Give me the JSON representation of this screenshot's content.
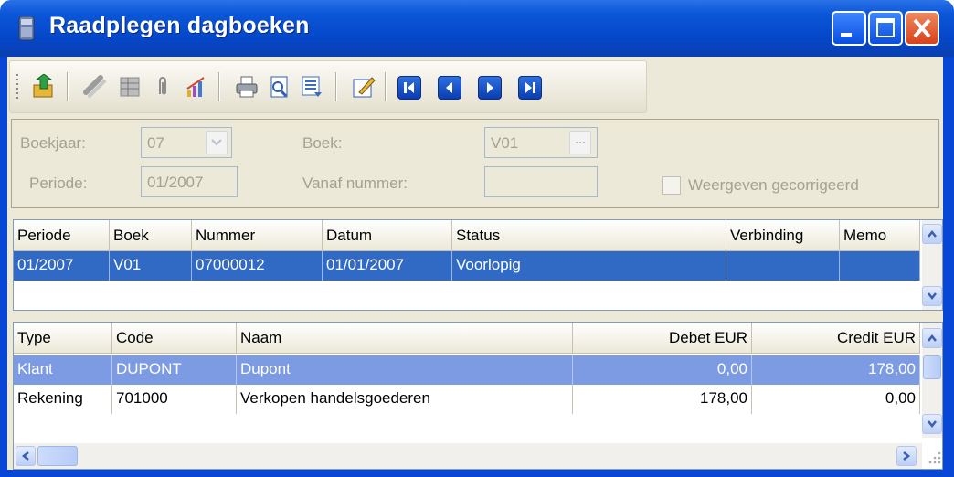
{
  "window": {
    "title": "Raadplegen dagboeken"
  },
  "toolbar": {
    "icons": [
      "export-icon",
      "link-icon",
      "grid-icon",
      "paperclip-icon",
      "chart-icon",
      "print-icon",
      "preview-icon",
      "list-icon",
      "edit-icon",
      "first-record-icon",
      "previous-record-icon",
      "next-record-icon",
      "last-record-icon"
    ]
  },
  "filter": {
    "boekjaar_label": "Boekjaar:",
    "boekjaar_value": "07",
    "boek_label": "Boek:",
    "boek_value": "V01",
    "periode_label": "Periode:",
    "periode_value": "01/2007",
    "vanaf_label": "Vanaf nummer:",
    "vanaf_value": "",
    "corr_label": "Weergeven gecorrigeerd"
  },
  "journal": {
    "columns": [
      "Periode",
      "Boek",
      "Nummer",
      "Datum",
      "Status",
      "Verbinding",
      "Memo"
    ],
    "rows": [
      [
        "01/2007",
        "V01",
        "07000012",
        "01/01/2007",
        "Voorlopig",
        "",
        ""
      ]
    ]
  },
  "lines": {
    "columns": [
      "Type",
      "Code",
      "Naam",
      "Debet EUR",
      "Credit EUR"
    ],
    "rows": [
      [
        "Klant",
        "DUPONT",
        "Dupont",
        "0,00",
        "178,00"
      ],
      [
        "Rekening",
        "701000",
        "Verkopen handelsgoederen",
        "178,00",
        "0,00"
      ]
    ]
  },
  "colors": {
    "selection": "#316ac5",
    "selection_light": "#7c9be3",
    "titlebar": "#0a4ee0"
  }
}
